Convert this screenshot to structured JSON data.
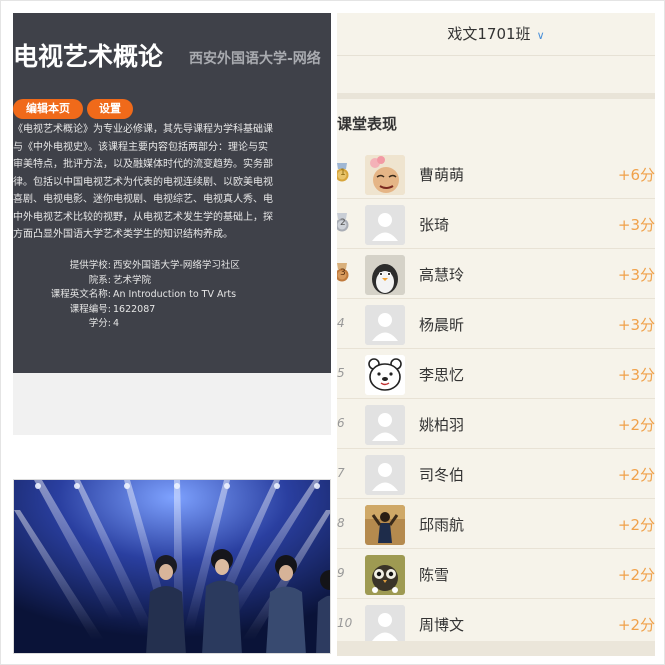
{
  "course": {
    "title": "电视艺术概论",
    "school": "西安外国语大学-网络",
    "buttons": {
      "edit": "编辑本页",
      "settings": "设置"
    },
    "description_lines": [
      "《电视艺术概论》为专业必修课，其先导课程为学科基础课",
      "与《中外电视史》。该课程主要内容包括两部分：理论与实",
      "审美特点，批评方法，以及融媒体时代的流变趋势。实务部",
      "律。包括以中国电视艺术为代表的电视连续剧、以欧美电视",
      "喜剧、电视电影、迷你电视剧、电视综艺、电视真人秀、电",
      "中外电视艺术比较的视野，从电视艺术发生学的基础上，探",
      "方面凸显外国语大学艺术类学生的知识结构养成。"
    ],
    "info": [
      {
        "label": "提供学校:",
        "value": "西安外国语大学-网络学习社区"
      },
      {
        "label": "院系:",
        "value": "艺术学院"
      },
      {
        "label": "课程英文名称:",
        "value": "An Introduction to TV Arts"
      },
      {
        "label": "课程编号:",
        "value": "1622087"
      },
      {
        "label": "学分:",
        "value": "4"
      }
    ]
  },
  "classroom": {
    "class_name": "戏文1701班",
    "section_title": "课堂表现",
    "colors": {
      "score": "#f0a14a",
      "gold": "#d7a53b",
      "silver": "#a9adb5",
      "bronze": "#c07a3c"
    },
    "students": [
      {
        "rank": "1",
        "medal": "gold",
        "avatar": "cartoon-face",
        "name": "曹萌萌",
        "score": "+6分"
      },
      {
        "rank": "2",
        "medal": "silver",
        "avatar": "default",
        "name": "张琦",
        "score": "+3分"
      },
      {
        "rank": "3",
        "medal": "bronze",
        "avatar": "penguin",
        "name": "高慧玲",
        "score": "+3分"
      },
      {
        "rank": "4",
        "medal": "",
        "avatar": "default",
        "name": "杨晨昕",
        "score": "+3分"
      },
      {
        "rank": "5",
        "medal": "",
        "avatar": "bear",
        "name": "李思忆",
        "score": "+3分"
      },
      {
        "rank": "6",
        "medal": "",
        "avatar": "default",
        "name": "姚柏羽",
        "score": "+2分"
      },
      {
        "rank": "7",
        "medal": "",
        "avatar": "default",
        "name": "司冬伯",
        "score": "+2分"
      },
      {
        "rank": "8",
        "medal": "",
        "avatar": "person-photo",
        "name": "邱雨航",
        "score": "+2分"
      },
      {
        "rank": "9",
        "medal": "",
        "avatar": "owl",
        "name": "陈雪",
        "score": "+2分"
      },
      {
        "rank": "10",
        "medal": "",
        "avatar": "default",
        "name": "周博文",
        "score": "+2分"
      }
    ]
  }
}
